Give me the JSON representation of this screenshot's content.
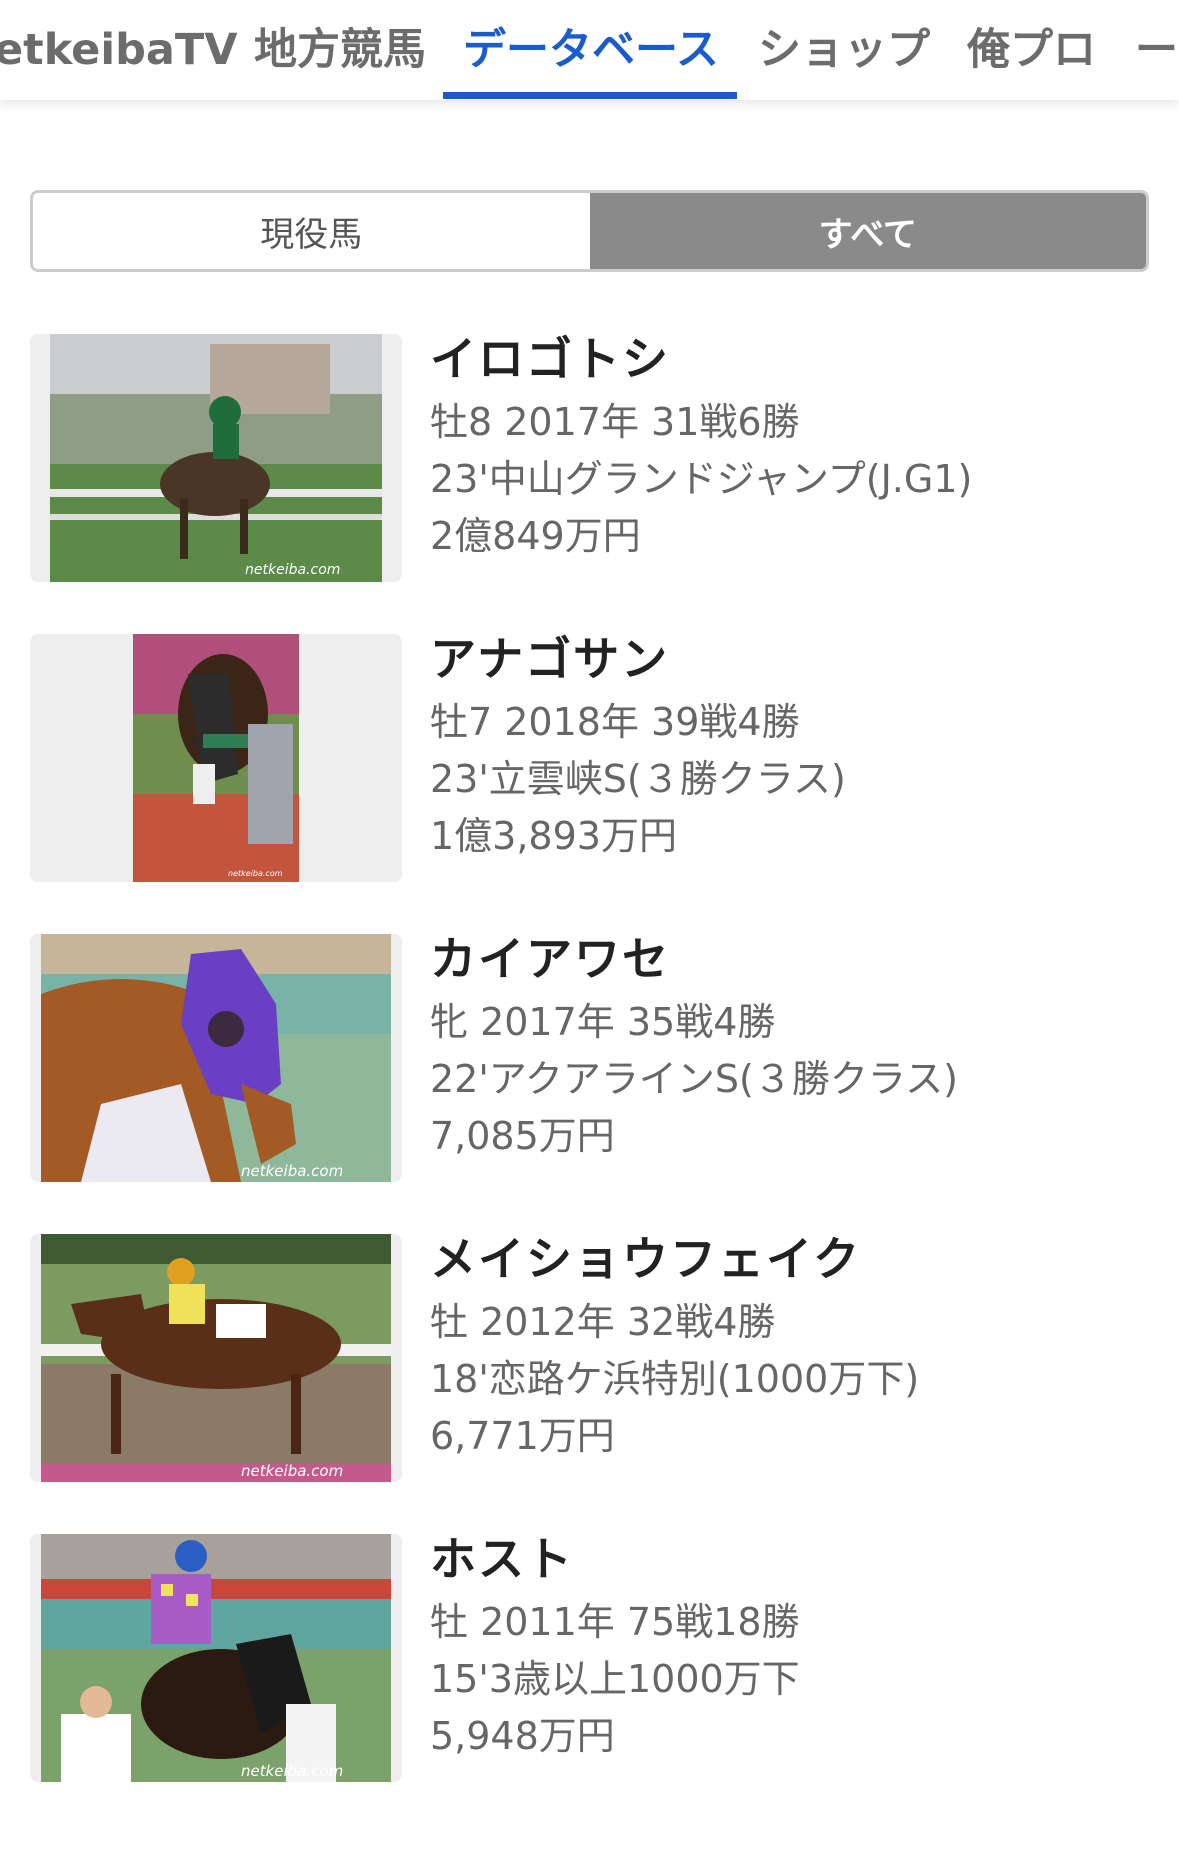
{
  "nav": {
    "tabs": [
      {
        "label": "etkeibaTV",
        "active": false
      },
      {
        "label": "地方競馬",
        "active": false
      },
      {
        "label": "データベース",
        "active": true
      },
      {
        "label": "ショップ",
        "active": false
      },
      {
        "label": "俺プロ",
        "active": false
      },
      {
        "label": "ー",
        "active": false
      }
    ]
  },
  "toggle": {
    "options": [
      {
        "label": "現役馬",
        "selected": false
      },
      {
        "label": "すべて",
        "selected": true
      }
    ]
  },
  "horses": [
    {
      "name": "イロゴトシ",
      "profile": "牡8 2017年 31戦6勝",
      "best_race": "23'中山グランドジャンプ(J.G1)",
      "earnings": "2億849万円",
      "photo": "green-jockey-steeplechase"
    },
    {
      "name": "アナゴサン",
      "profile": "牡7 2018年 39戦4勝",
      "best_race": "23'立雲峡S(３勝クラス)",
      "earnings": "1億3,893万円",
      "photo": "horse-paddock-portrait"
    },
    {
      "name": "カイアワセ",
      "profile": "牝 2017年 35戦4勝",
      "best_race": "22'アクアラインS(３勝クラス)",
      "earnings": "7,085万円",
      "photo": "purple-hood-horse"
    },
    {
      "name": "メイショウフェイク",
      "profile": "牡 2012年 32戦4勝",
      "best_race": "18'恋路ケ浜特別(1000万下)",
      "earnings": "6,771万円",
      "photo": "racehorse-on-track"
    },
    {
      "name": "ホスト",
      "profile": "牡 2011年 75戦18勝",
      "best_race": "15'3歳以上1000万下",
      "earnings": "5,948万円",
      "photo": "jockey-with-horse-paddock"
    }
  ],
  "colors": {
    "accent": "#1a5ccc",
    "selected_segment": "#8a8a8a"
  }
}
